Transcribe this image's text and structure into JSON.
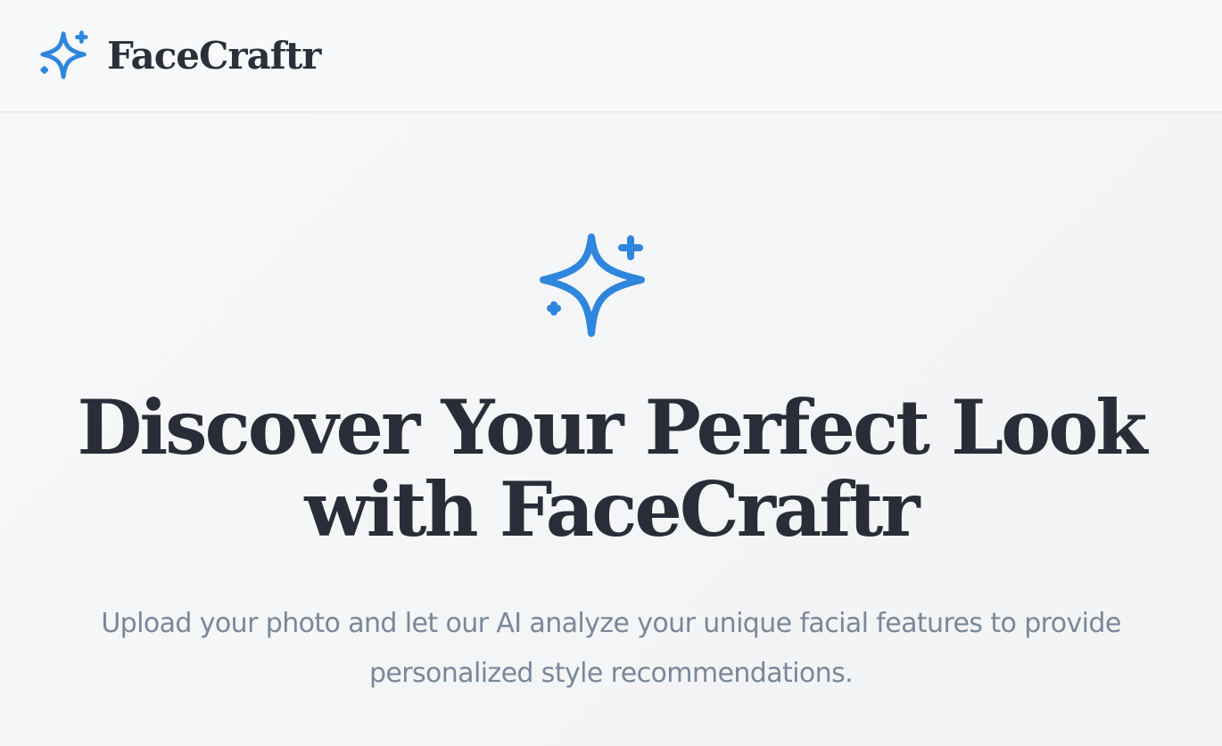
{
  "brand": {
    "name": "FaceCraftr",
    "icon": "sparkles-icon",
    "accent_color": "#2f86de"
  },
  "hero": {
    "icon": "sparkles-icon",
    "title": "Discover Your Perfect Look with FaceCraftr",
    "subtitle": "Upload your photo and let our AI analyze your unique facial features to provide personalized style recommendations."
  },
  "colors": {
    "text_dark": "#292d37",
    "text_muted": "#7a8799",
    "background": "#f5f6f8"
  }
}
